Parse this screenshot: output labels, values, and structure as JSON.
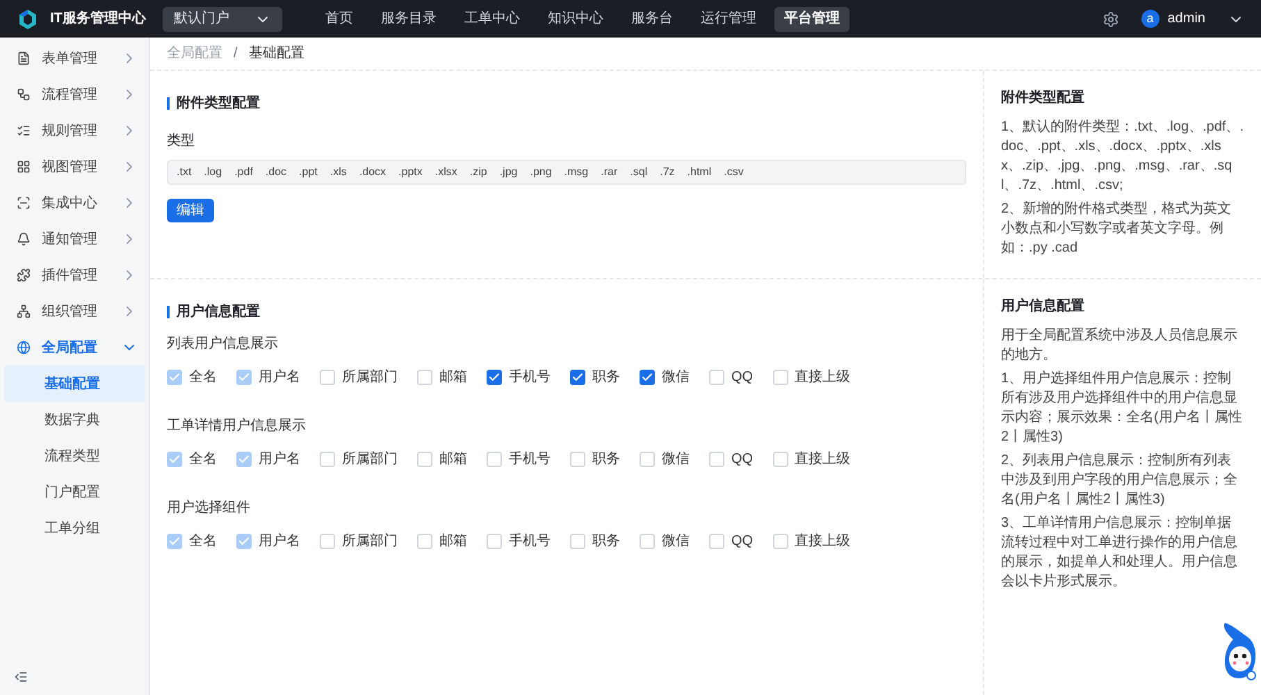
{
  "topbar": {
    "title": "IT服务管理中心",
    "portal_select": "默认门户",
    "nav": [
      {
        "label": "首页",
        "selected": false
      },
      {
        "label": "服务目录",
        "selected": false
      },
      {
        "label": "工单中心",
        "selected": false
      },
      {
        "label": "知识中心",
        "selected": false
      },
      {
        "label": "服务台",
        "selected": false
      },
      {
        "label": "运行管理",
        "selected": false
      },
      {
        "label": "平台管理",
        "selected": true
      }
    ],
    "user": {
      "avatar_letter": "a",
      "name": "admin"
    }
  },
  "sidebar": {
    "items": [
      {
        "label": "表单管理",
        "expanded": false
      },
      {
        "label": "流程管理",
        "expanded": false
      },
      {
        "label": "规则管理",
        "expanded": false
      },
      {
        "label": "视图管理",
        "expanded": false
      },
      {
        "label": "集成中心",
        "expanded": false
      },
      {
        "label": "通知管理",
        "expanded": false
      },
      {
        "label": "插件管理",
        "expanded": false
      },
      {
        "label": "组织管理",
        "expanded": false
      },
      {
        "label": "全局配置",
        "expanded": true,
        "children": [
          {
            "label": "基础配置",
            "selected": true
          },
          {
            "label": "数据字典",
            "selected": false
          },
          {
            "label": "流程类型",
            "selected": false
          },
          {
            "label": "门户配置",
            "selected": false
          },
          {
            "label": "工单分组",
            "selected": false
          }
        ]
      }
    ]
  },
  "breadcrumb": {
    "separator": "/",
    "items": [
      "全局配置",
      "基础配置"
    ]
  },
  "attachment_section": {
    "title": "附件类型配置",
    "field_label": "类型",
    "types": [
      ".txt",
      ".log",
      ".pdf",
      ".doc",
      ".ppt",
      ".xls",
      ".docx",
      ".pptx",
      ".xlsx",
      ".zip",
      ".jpg",
      ".png",
      ".msg",
      ".rar",
      ".sql",
      ".7z",
      ".html",
      ".csv"
    ],
    "button": "编辑",
    "help": {
      "title": "附件类型配置",
      "paragraphs": [
        "1、默认的附件类型：.txt、.log、.pdf、.doc、.ppt、.xls、.docx、.pptx、.xlsx、.zip、.jpg、.png、.msg、.rar、.sql、.7z、.html、.csv;",
        "2、新增的附件格式类型，格式为英文小数点和小写数字或者英文字母。例如：.py .cad"
      ]
    }
  },
  "user_section": {
    "title": "用户信息配置",
    "groups": [
      {
        "label": "列表用户信息展示",
        "options": [
          {
            "label": "全名",
            "checked": true,
            "disabled": true
          },
          {
            "label": "用户名",
            "checked": true,
            "disabled": true
          },
          {
            "label": "所属部门",
            "checked": false,
            "disabled": false
          },
          {
            "label": "邮箱",
            "checked": false,
            "disabled": false
          },
          {
            "label": "手机号",
            "checked": true,
            "disabled": false
          },
          {
            "label": "职务",
            "checked": true,
            "disabled": false
          },
          {
            "label": "微信",
            "checked": true,
            "disabled": false
          },
          {
            "label": "QQ",
            "checked": false,
            "disabled": false
          },
          {
            "label": "直接上级",
            "checked": false,
            "disabled": false
          }
        ]
      },
      {
        "label": "工单详情用户信息展示",
        "options": [
          {
            "label": "全名",
            "checked": true,
            "disabled": true
          },
          {
            "label": "用户名",
            "checked": true,
            "disabled": true
          },
          {
            "label": "所属部门",
            "checked": false,
            "disabled": false
          },
          {
            "label": "邮箱",
            "checked": false,
            "disabled": false
          },
          {
            "label": "手机号",
            "checked": false,
            "disabled": false
          },
          {
            "label": "职务",
            "checked": false,
            "disabled": false
          },
          {
            "label": "微信",
            "checked": false,
            "disabled": false
          },
          {
            "label": "QQ",
            "checked": false,
            "disabled": false
          },
          {
            "label": "直接上级",
            "checked": false,
            "disabled": false
          }
        ]
      },
      {
        "label": "用户选择组件",
        "options": [
          {
            "label": "全名",
            "checked": true,
            "disabled": true
          },
          {
            "label": "用户名",
            "checked": true,
            "disabled": true
          },
          {
            "label": "所属部门",
            "checked": false,
            "disabled": false
          },
          {
            "label": "邮箱",
            "checked": false,
            "disabled": false
          },
          {
            "label": "手机号",
            "checked": false,
            "disabled": false
          },
          {
            "label": "职务",
            "checked": false,
            "disabled": false
          },
          {
            "label": "微信",
            "checked": false,
            "disabled": false
          },
          {
            "label": "QQ",
            "checked": false,
            "disabled": false
          },
          {
            "label": "直接上级",
            "checked": false,
            "disabled": false
          }
        ]
      }
    ],
    "help": {
      "title": "用户信息配置",
      "paragraphs": [
        "用于全局配置系统中涉及人员信息展示的地方。",
        "1、用户选择组件用户信息展示：控制所有涉及用户选择组件中的用户信息显示内容；展示效果：全名(用户名丨属性2丨属性3)",
        "2、列表用户信息展示：控制所有列表中涉及到用户字段的用户信息展示；全名(用户名丨属性2丨属性3)",
        "3、工单详情用户信息展示：控制单据流转过程中对工单进行操作的用户信息的展示，如提单人和处理人。用户信息会以卡片形式展示。"
      ]
    }
  }
}
